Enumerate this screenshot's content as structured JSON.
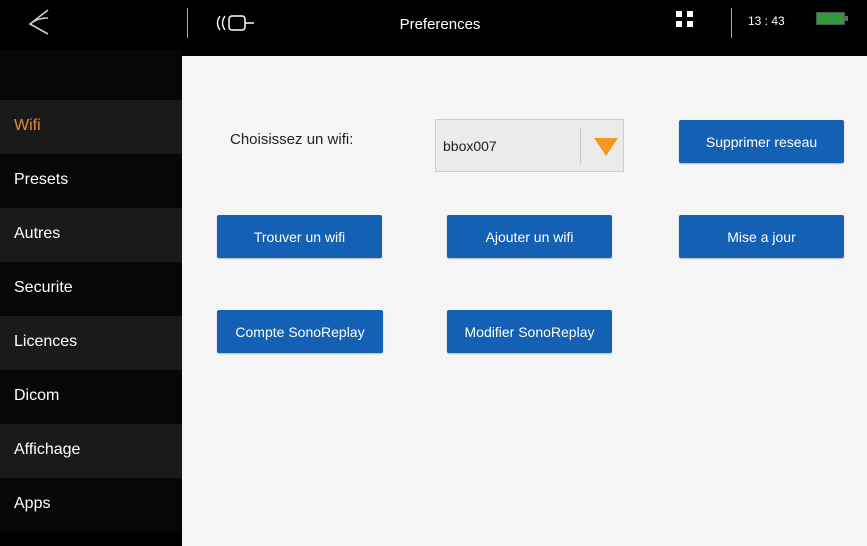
{
  "topbar": {
    "title": "Preferences",
    "time": "13 : 43",
    "back_icon": "back-swoosh-icon",
    "probe_icon": "probe-icon",
    "grid_icon": "grid-icon",
    "battery_icon": "battery-icon",
    "battery_color": "#2f9a3a"
  },
  "sidebar": {
    "items": [
      {
        "label": "Wifi",
        "active": true
      },
      {
        "label": "Presets"
      },
      {
        "label": "Autres"
      },
      {
        "label": "Securite"
      },
      {
        "label": "Licences"
      },
      {
        "label": "Dicom"
      },
      {
        "label": "Affichage"
      },
      {
        "label": "Apps"
      }
    ],
    "active_color": "#e8892d"
  },
  "wifi": {
    "label": "Choisissez un wifi:",
    "selected": "bbox007",
    "arrow_color": "#f29a1e"
  },
  "buttons": {
    "delete_network": "Supprimer reseau",
    "find_wifi": "Trouver un wifi",
    "add_wifi": "Ajouter un wifi",
    "update": "Mise a jour",
    "sonoreplay_account": "Compte SonoReplay",
    "edit_sonoreplay": "Modifier SonoReplay"
  },
  "colors": {
    "button_bg": "#1460b4",
    "content_bg": "#f5f5f5"
  }
}
